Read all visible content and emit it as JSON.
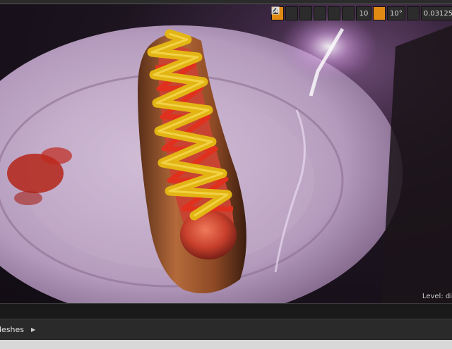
{
  "viewport_toolbar": {
    "grid_snap_value": "10",
    "rotation_snap_value": "10°",
    "scale_snap_value": "0.03125",
    "icons": [
      "translate-icon",
      "rotate-icon",
      "scale-icon",
      "world-local-icon",
      "surface-snap-icon",
      "grid-icon",
      "angle-icon",
      "scale-snap-icon"
    ],
    "accent_color": "#e08a13"
  },
  "viewport": {
    "level_text": "Level: di"
  },
  "content_browser": {
    "breadcrumb": "leshes"
  }
}
